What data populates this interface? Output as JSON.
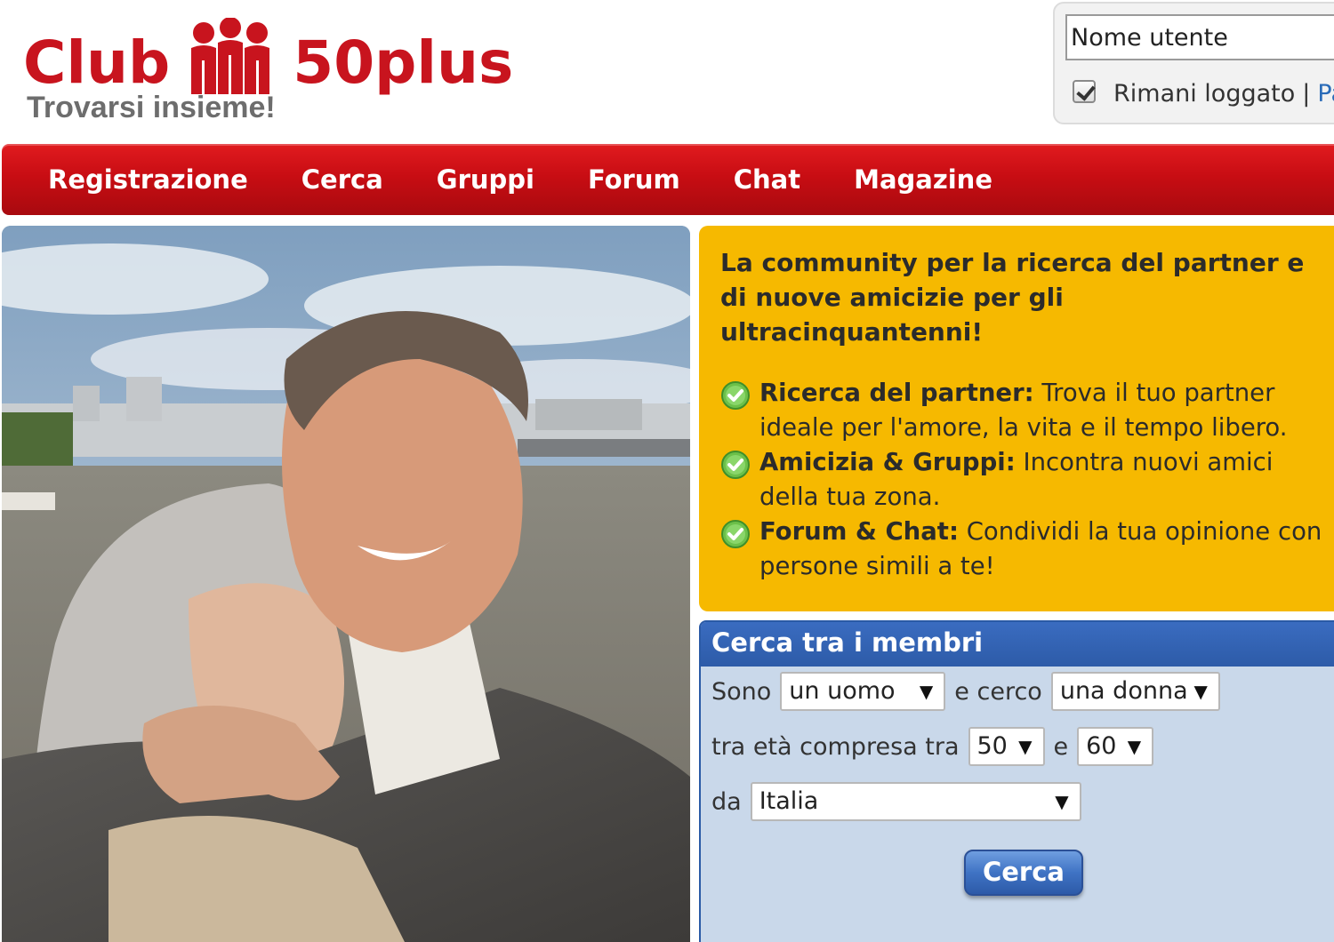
{
  "brand": {
    "name_part1": "Club",
    "name_part2": "50plus",
    "tagline": "Trovarsi insieme!",
    "brand_color": "#c8141e",
    "logo_icon": "people-group-icon"
  },
  "login": {
    "username_placeholder": "Nome utente",
    "remember_label": "Rimani loggato",
    "remember_checked": true,
    "separator": "|",
    "forgot_link_partial": "Pa"
  },
  "nav": {
    "items": [
      {
        "label": "Registrazione"
      },
      {
        "label": "Cerca"
      },
      {
        "label": "Gruppi"
      },
      {
        "label": "Forum"
      },
      {
        "label": "Chat"
      },
      {
        "label": "Magazine"
      }
    ],
    "color": "#c80d13"
  },
  "hero": {
    "photo": "couple-embracing-by-river-photo"
  },
  "info": {
    "headline": "La community per la ricerca del partner e di nuove amicizie per gli ultracinquantenni!",
    "background": "#f6b900",
    "features": [
      {
        "icon": "check-circle-icon",
        "title": "Ricerca del partner:",
        "text": "Trova il tuo partner ideale per l'amore, la vita e il tempo libero."
      },
      {
        "icon": "check-circle-icon",
        "title": "Amicizia & Gruppi:",
        "text": "Incontra nuovi amici della tua zona."
      },
      {
        "icon": "check-circle-icon",
        "title": "Forum & Chat:",
        "text": "Condividi la tua opinione con persone simili a te!"
      }
    ]
  },
  "search": {
    "title": "Cerca tra i membri",
    "i_am_label": "Sono",
    "i_am_value": "un uomo",
    "seeking_label": "e cerco",
    "seeking_value": "una donna",
    "age_label": "tra età compresa tra",
    "age_min": "50",
    "age_and": "e",
    "age_max": "60",
    "from_label": "da",
    "country_value": "Italia",
    "dropdown_arrow": "▼",
    "submit_label": "Cerca",
    "panel_color": "#c9d8ea",
    "header_color": "#2d5ba8"
  }
}
